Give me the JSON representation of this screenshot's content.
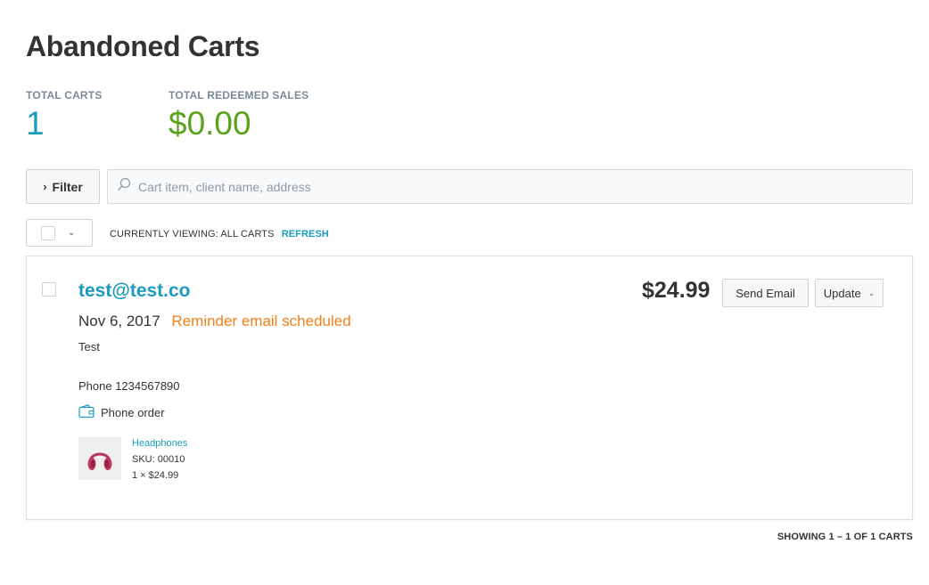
{
  "page": {
    "title": "Abandoned Carts"
  },
  "stats": {
    "total_carts_label": "TOTAL CARTS",
    "total_carts_value": "1",
    "total_sales_label": "TOTAL REDEEMED SALES",
    "total_sales_value": "$0.00"
  },
  "toolbar": {
    "filter_label": "Filter",
    "search_placeholder": "Cart item, client name, address",
    "viewing_text": "CURRENTLY VIEWING: ALL CARTS",
    "refresh_label": "REFRESH"
  },
  "cart": {
    "email": "test@test.co",
    "date": "Nov 6, 2017",
    "status": "Reminder email scheduled",
    "note": "Test",
    "phone": "Phone 1234567890",
    "order_type": "Phone order",
    "total": "$24.99",
    "send_email_label": "Send Email",
    "update_label": "Update",
    "items": [
      {
        "name": "Headphones",
        "sku": "SKU: 00010",
        "qty_price": "1 × $24.99",
        "icon": "headphones-icon"
      }
    ]
  },
  "pagination": {
    "text": "SHOWING 1 – 1 OF 1 CARTS"
  },
  "colors": {
    "accent": "#1a9bbf",
    "success": "#5aa21a",
    "warning": "#ef7f1a"
  }
}
